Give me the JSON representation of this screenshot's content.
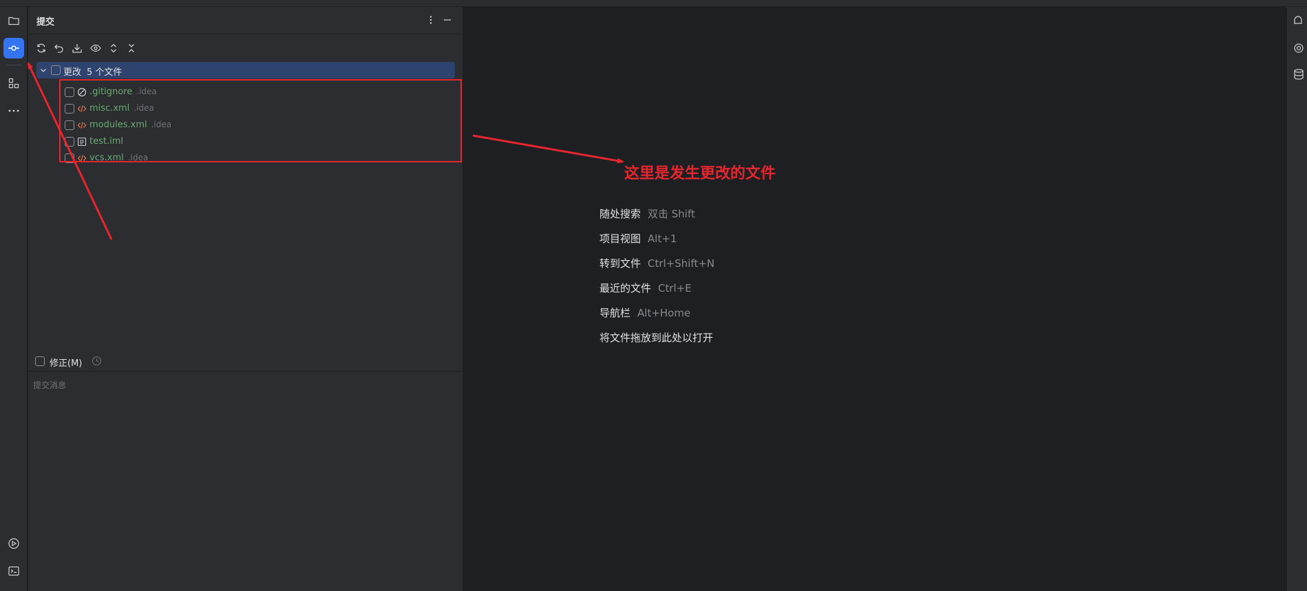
{
  "panel": {
    "title": "提交"
  },
  "changes": {
    "group_label": "更改",
    "group_count": "5 个文件",
    "files": [
      {
        "name": ".gitignore",
        "dir": ".idea",
        "icon": "gitignore-icon"
      },
      {
        "name": "misc.xml",
        "dir": ".idea",
        "icon": "xml-icon"
      },
      {
        "name": "modules.xml",
        "dir": ".idea",
        "icon": "xml-icon"
      },
      {
        "name": "test.iml",
        "dir": "",
        "icon": "iml-icon"
      },
      {
        "name": "vcs.xml",
        "dir": ".idea",
        "icon": "xml-icon"
      }
    ]
  },
  "amend": {
    "label": "修正(M)"
  },
  "commit_message": {
    "placeholder": "提交消息"
  },
  "editor_hints": [
    {
      "label": "随处搜索",
      "key": "双击 Shift"
    },
    {
      "label": "项目视图",
      "key": "Alt+1"
    },
    {
      "label": "转到文件",
      "key": "Ctrl+Shift+N"
    },
    {
      "label": "最近的文件",
      "key": "Ctrl+E"
    },
    {
      "label": "导航栏",
      "key": "Alt+Home"
    },
    {
      "label": "将文件拖放到此处以打开",
      "key": ""
    }
  ],
  "annotation": {
    "text": "这里是发生更改的文件",
    "color": "#e5262f"
  },
  "colors": {
    "accent": "#3574f0",
    "selection": "#2e436e",
    "new_file_green": "#6aab73"
  }
}
